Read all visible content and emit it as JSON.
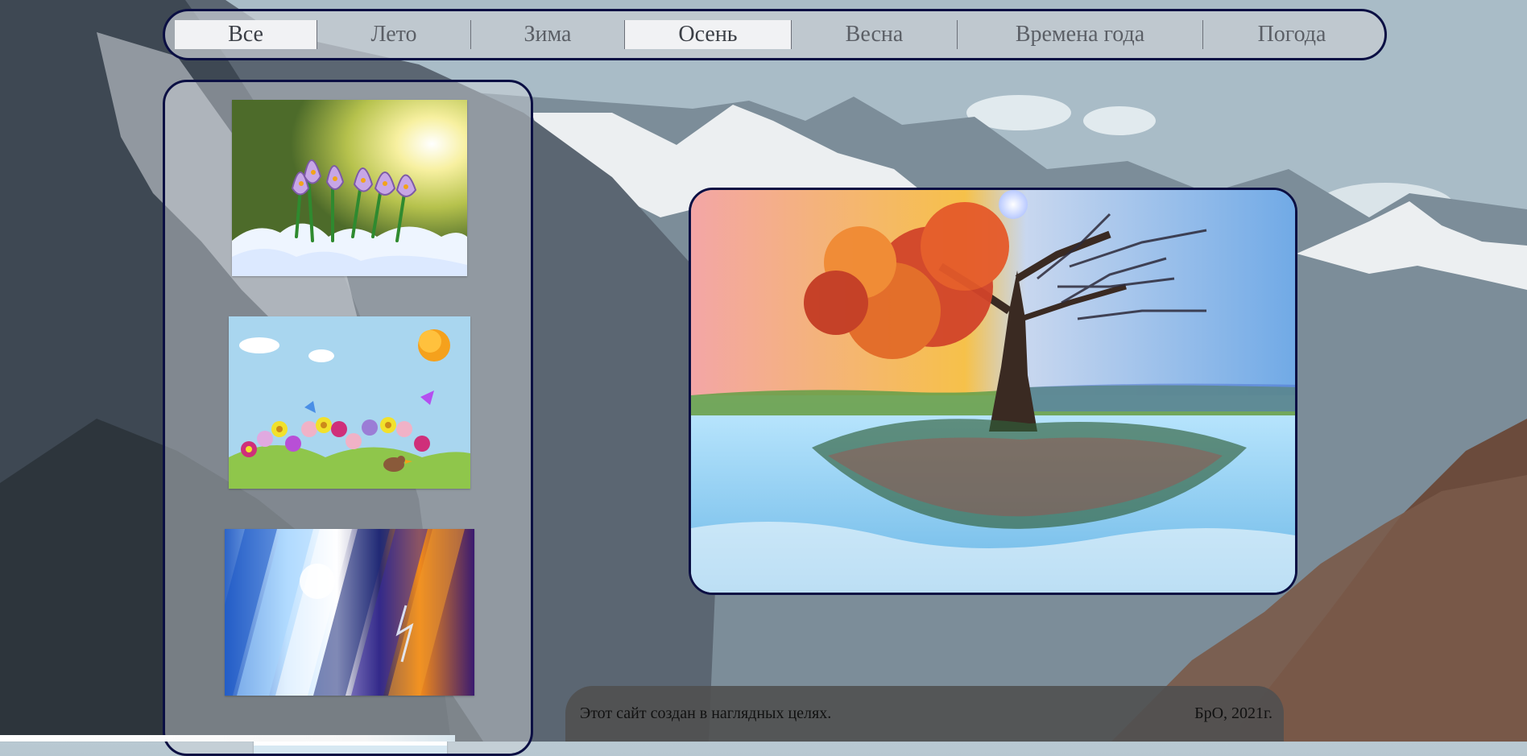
{
  "nav": {
    "tabs": [
      {
        "label": "Все",
        "active": true
      },
      {
        "label": "Лето",
        "active": false
      },
      {
        "label": "Зима",
        "active": false
      },
      {
        "label": "Осень",
        "active": true
      },
      {
        "label": "Весна",
        "active": false
      },
      {
        "label": "Времена года",
        "active": false
      },
      {
        "label": "Погода",
        "active": false
      }
    ]
  },
  "sidebar": {
    "thumbnails": [
      {
        "name": "crocus-in-snow-thumbnail"
      },
      {
        "name": "spring-cartoon-thumbnail"
      },
      {
        "name": "weather-collage-thumbnail"
      },
      {
        "name": "partial-thumbnail"
      }
    ]
  },
  "main": {
    "image_name": "four-seasons-tree-image"
  },
  "footer": {
    "left_text": "Этот сайт создан в наглядных целях.",
    "right_text": "БрО, 2021г."
  },
  "colors": {
    "accent_border": "#0b0f43"
  }
}
